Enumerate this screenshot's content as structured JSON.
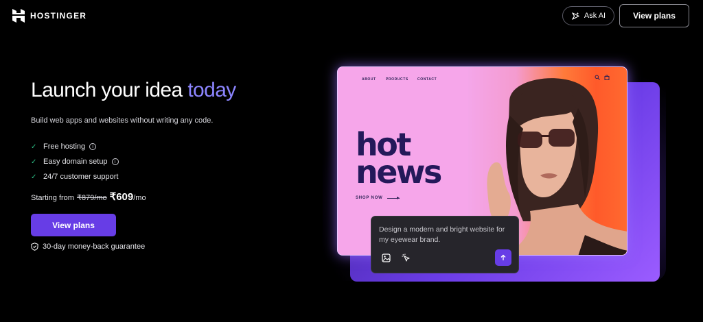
{
  "header": {
    "brand": "HOSTINGER",
    "ask_ai_label": "Ask AI",
    "view_plans_label": "View plans"
  },
  "hero": {
    "title_main": "Launch your idea ",
    "title_accent": "today",
    "subtitle": "Build web apps and websites without writing any code.",
    "features": [
      {
        "label": "Free hosting",
        "info": true
      },
      {
        "label": "Easy domain setup",
        "info": true
      },
      {
        "label": "24/7 customer support",
        "info": false
      }
    ],
    "price_prefix": "Starting from",
    "price_old": "₹879/mo",
    "price_new": "₹609",
    "price_suffix": "/mo",
    "cta_label": "View plans",
    "guarantee": "30-day money-back guarantee"
  },
  "mock_site": {
    "nav": [
      "ABOUT",
      "PRODUCTS",
      "CONTACT"
    ],
    "headline_line1": "hot",
    "headline_line2": "news",
    "shop_now": "SHOP NOW"
  },
  "prompt_box": {
    "text": "Design a modern and bright website for my eyewear brand."
  },
  "colors": {
    "accent": "#673de6",
    "accent_text": "#8c85ff",
    "check": "#2ec489",
    "background": "#000000"
  }
}
